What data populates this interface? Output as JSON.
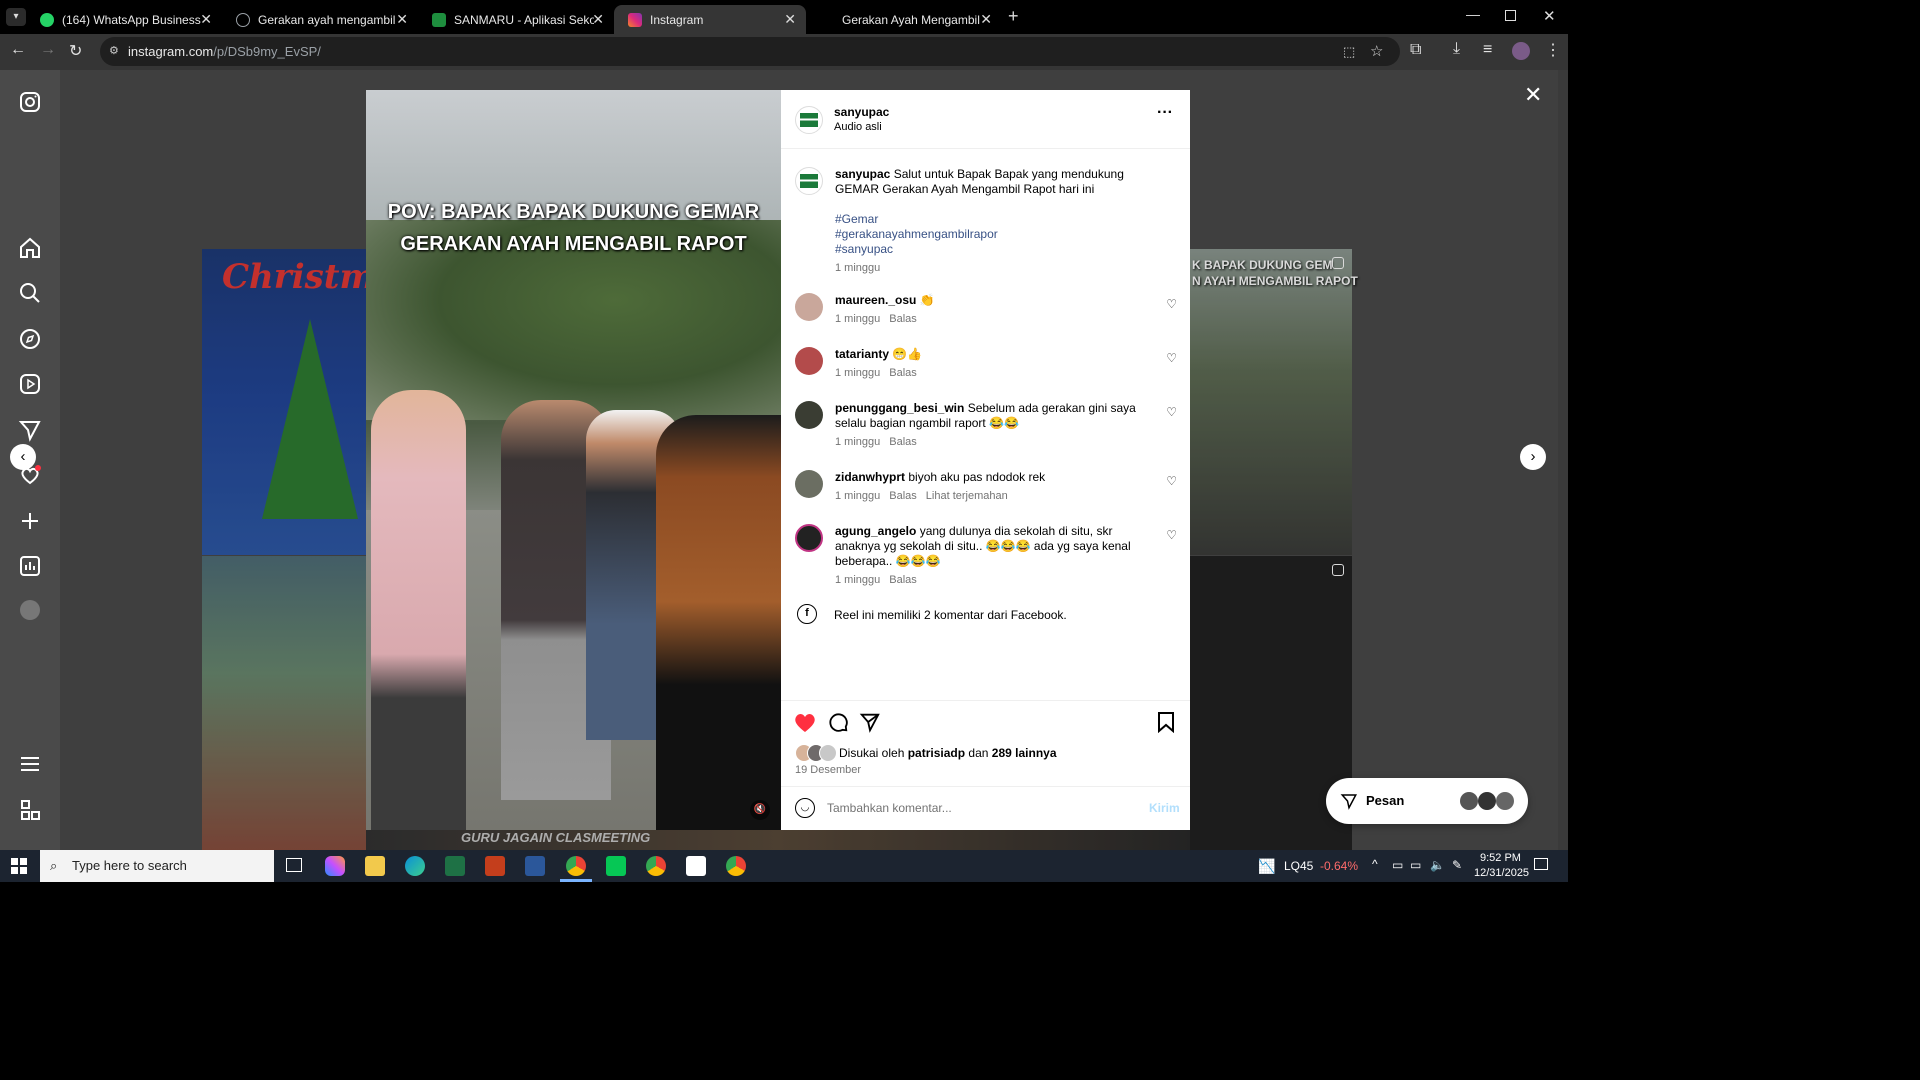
{
  "browser": {
    "tabs": [
      {
        "title": "(164) WhatsApp Business",
        "color": "#25d366"
      },
      {
        "title": "Gerakan ayah mengambil Rapor",
        "color": "#9aa0a6"
      },
      {
        "title": "SANMARU - Aplikasi Sekolah S",
        "color": "#1e8e3e"
      },
      {
        "title": "Instagram",
        "color": "#e1306c"
      },
      {
        "title": "Gerakan Ayah Mengambil Rapo",
        "color": "#9aa0a6"
      }
    ],
    "url_host": "instagram.com",
    "url_path": "/p/DSb9my_EvSP/"
  },
  "post": {
    "video_caption_line1": "POV: BAPAK BAPAK DUKUNG GEMAR",
    "video_caption_line2": "GERAKAN AYAH MENGABIL RAPOT",
    "author": "sanyupac",
    "audio": "Audio asli",
    "caption_text": "Salut untuk Bapak Bapak yang mendukung GEMAR Gerakan Ayah Mengambil Rapot hari ini",
    "hashtags": [
      "#Gemar",
      "#gerakanayahmengambilrapor",
      "#sanyupac"
    ],
    "caption_time": "1 minggu",
    "comments": [
      {
        "user": "maureen._osu",
        "text": "👏",
        "time": "1 minggu",
        "reply": "Balas",
        "translate": ""
      },
      {
        "user": "tatarianty",
        "text": "😁👍",
        "time": "1 minggu",
        "reply": "Balas",
        "translate": ""
      },
      {
        "user": "penunggang_besi_win",
        "text": "Sebelum ada gerakan gini saya selalu bagian ngambil raport 😂😂",
        "time": "1 minggu",
        "reply": "Balas",
        "translate": ""
      },
      {
        "user": "zidanwhyprt",
        "text": "biyoh aku pas ndodok rek",
        "time": "1 minggu",
        "reply": "Balas",
        "translate": "Lihat terjemahan"
      },
      {
        "user": "agung_angelo",
        "text": "yang dulunya dia sekolah di situ, skr anaknya yg sekolah di situ.. 😂😂😂 ada yg saya kenal beberapa.. 😂😂😂",
        "time": "1 minggu",
        "reply": "Balas",
        "translate": ""
      }
    ],
    "facebook_note": "Reel ini memiliki 2 komentar dari Facebook.",
    "likes_prefix": "Disukai oleh",
    "likes_user": "patrisiadp",
    "likes_and": "dan",
    "likes_count": "289 lainnya",
    "date": "19 Desember",
    "comment_placeholder": "Tambahkan komentar...",
    "send_label": "Kirim"
  },
  "messages_label": "Pesan",
  "background_text": {
    "christmas": "Christmas",
    "right_caption": "K BAPAK DUKUNG GEM\nN AYAH MENGAMBIL RAPOT",
    "bottom_caption": "GURU JAGAIN CLASMEETING"
  },
  "taskbar": {
    "search_placeholder": "Type here to search",
    "ticker": "LQ45",
    "ticker_change": "-0.64%",
    "time": "9:52 PM",
    "date": "12/31/2025"
  }
}
